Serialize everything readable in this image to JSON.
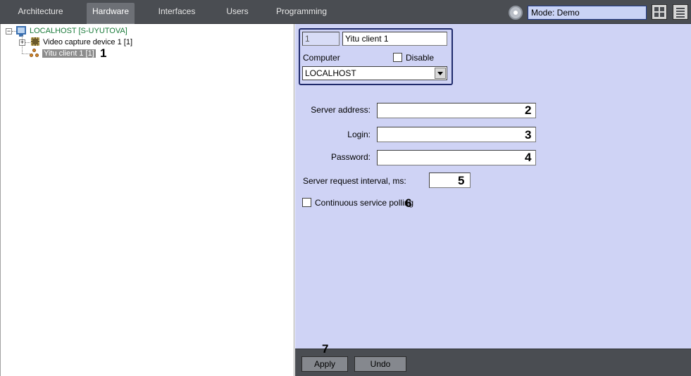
{
  "tabs": [
    {
      "label": "Architecture"
    },
    {
      "label": "Hardware"
    },
    {
      "label": "Interfaces"
    },
    {
      "label": "Users"
    },
    {
      "label": "Programming"
    }
  ],
  "mode": {
    "label": "Mode: Demo"
  },
  "tree": {
    "root": "LOCALHOST [S-UYUTOVA]",
    "items": [
      {
        "label": "Video capture device 1 [1]"
      },
      {
        "label": "Yitu client 1 [1]"
      }
    ]
  },
  "object": {
    "id_value": "1",
    "name_value": "Yitu client 1",
    "computer_label": "Computer",
    "disable_label": "Disable",
    "computer_value": "LOCALHOST"
  },
  "form": {
    "server_address_label": "Server address:",
    "server_address_value": "",
    "login_label": "Login:",
    "login_value": "",
    "password_label": "Password:",
    "password_value": "",
    "interval_label": "Server request interval, ms:",
    "interval_value": "",
    "polling_label": "Continuous service polling"
  },
  "buttons": {
    "apply": "Apply",
    "undo": "Undo"
  },
  "annotations": [
    "1",
    "2",
    "3",
    "4",
    "5",
    "6",
    "7"
  ],
  "colors": {
    "panel": "#cfd3f5",
    "bar": "#4a4d52",
    "mode_box": "#c9d3f5"
  }
}
